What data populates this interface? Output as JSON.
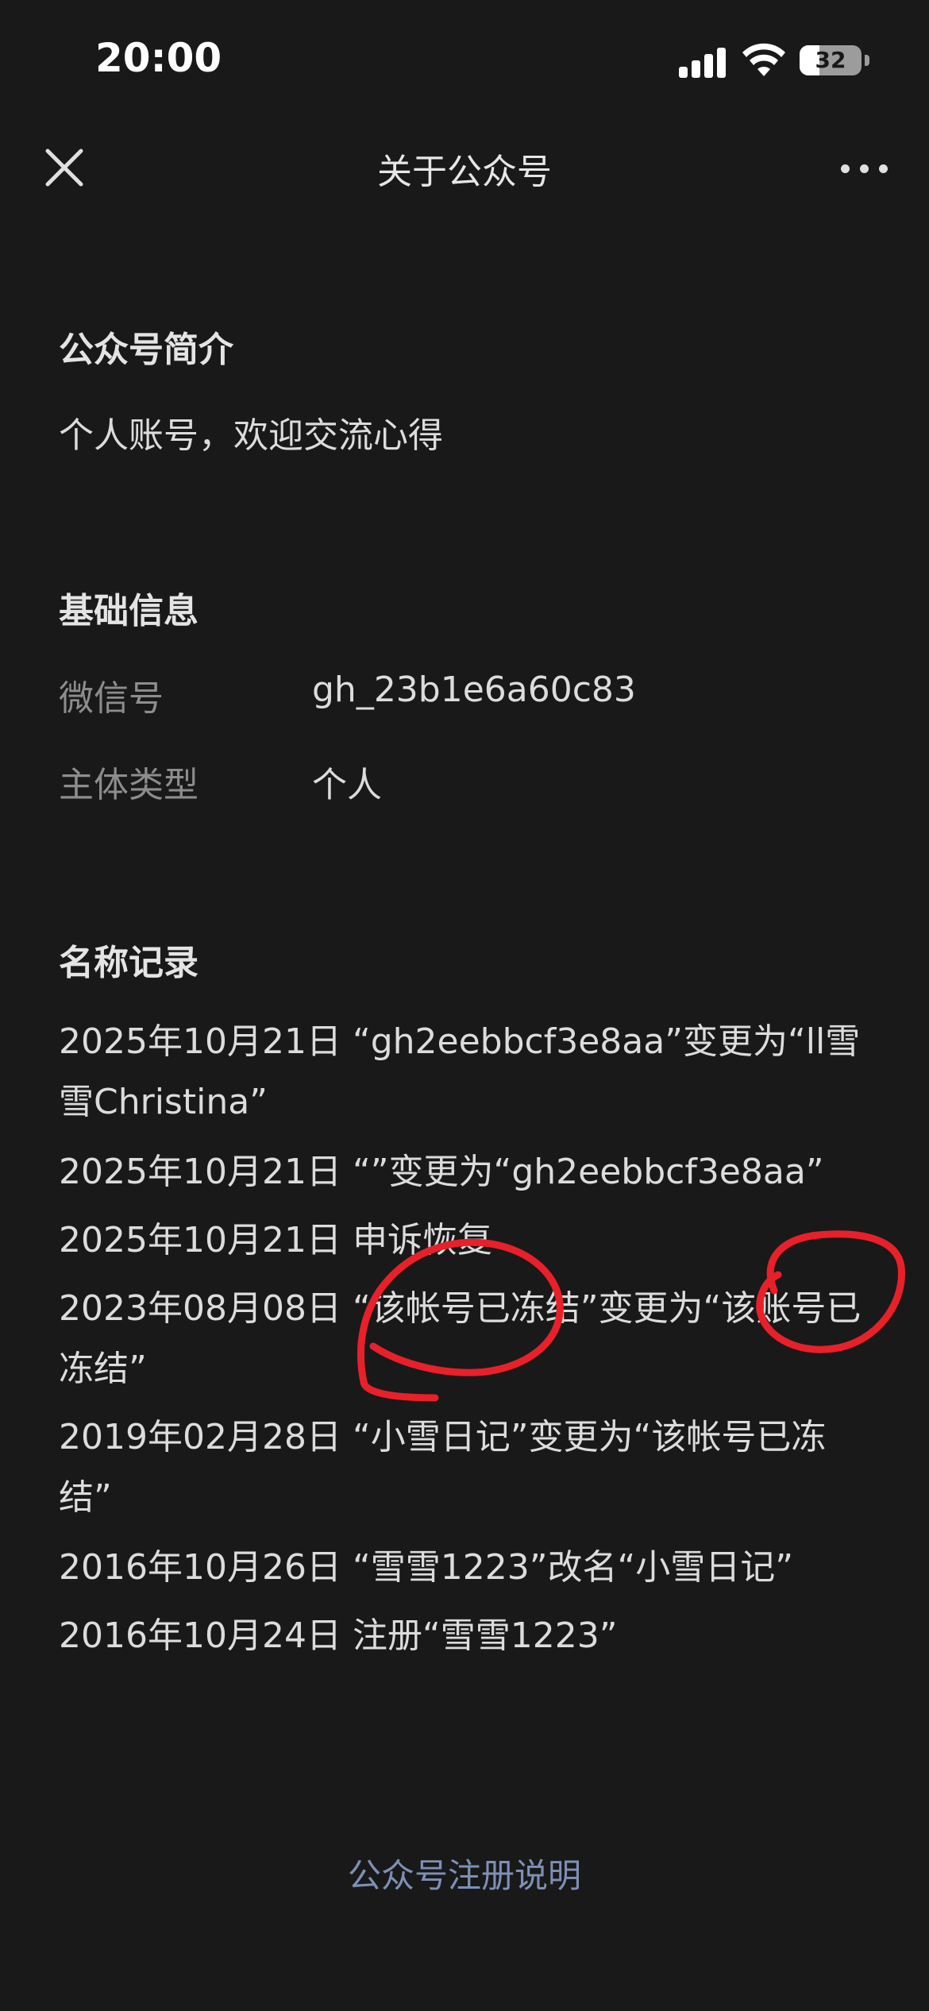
{
  "status_bar": {
    "time": "20:00",
    "battery_level": "32",
    "icons": [
      "cellular-signal-icon",
      "wifi-icon",
      "battery-icon"
    ]
  },
  "nav": {
    "title": "关于公众号",
    "close_icon": "close-icon",
    "more_icon": "more-icon"
  },
  "intro": {
    "heading": "公众号简介",
    "text": "个人账号，欢迎交流心得"
  },
  "basic_info": {
    "heading": "基础信息",
    "rows": [
      {
        "label": "微信号",
        "value": "gh_23b1e6a60c83"
      },
      {
        "label": "主体类型",
        "value": "个人"
      }
    ]
  },
  "name_records": {
    "heading": "名称记录",
    "items": [
      "2025年10月21日 “gh2eebbcf3e8aa”变更为“ll雪雪Christina”",
      "2025年10月21日 “”变更为“gh2eebbcf3e8aa”",
      "2025年10月21日 申诉恢复",
      "2023年08月08日 “该帐号已冻结”变更为“该账号已冻结”",
      "2019年02月28日 “小雪日记”变更为“该帐号已冻结”",
      "2016年10月26日 “雪雪1223”改名“小雪日记”",
      "2016年10月24日 注册“雪雪1223”"
    ]
  },
  "footer": {
    "link": "公众号注册说明"
  },
  "colors": {
    "background": "#191919",
    "link": "#7d90b6",
    "annotation": "#e8202a"
  }
}
